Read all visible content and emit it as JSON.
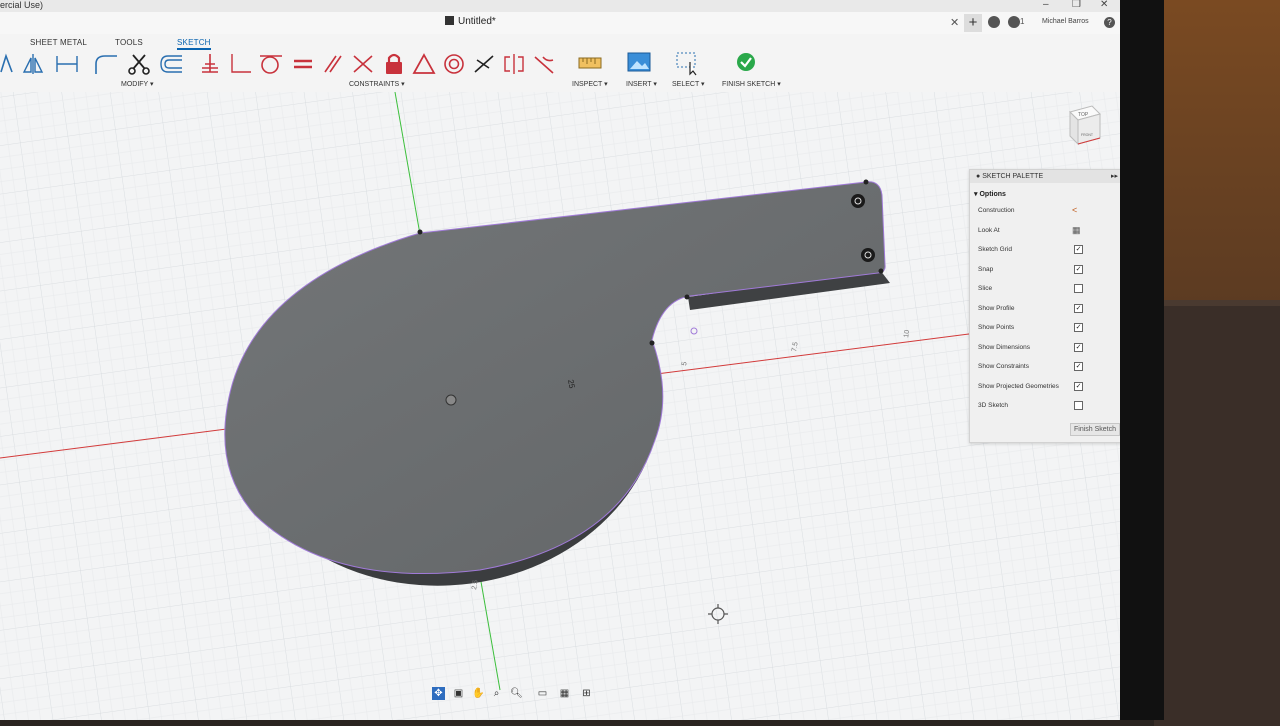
{
  "window": {
    "title_fragment": "ercial Use)",
    "document_title": "Untitled*",
    "notification_count": "1",
    "user_name": "Michael Barros",
    "help_glyph": "?"
  },
  "ribbon": {
    "tabs": [
      {
        "label": "SHEET METAL",
        "active": false
      },
      {
        "label": "TOOLS",
        "active": false
      },
      {
        "label": "SKETCH",
        "active": true
      }
    ],
    "groups": {
      "modify": "MODIFY ▾",
      "constraints": "CONSTRAINTS ▾",
      "inspect": "INSPECT ▾",
      "insert": "INSERT ▾",
      "select": "SELECT ▾",
      "finish": "FINISH SKETCH ▾"
    },
    "constraint_icons": [
      "horizontal-vertical-icon",
      "coincident-icon",
      "equal-icon",
      "parallel-icon",
      "perpendicular-icon",
      "fix-lock-icon",
      "midpoint-triangle-icon",
      "concentric-icon",
      "collinear-icon",
      "symmetry-icon",
      "tangent-icon"
    ],
    "colors": {
      "active_tab": "#0a64b0",
      "finish_green": "#2aa84a",
      "lock_red": "#c8323c"
    }
  },
  "viewport": {
    "dimension_label": "25",
    "axis_labels": [
      "5",
      "7.5",
      "10",
      "2.5"
    ],
    "viewcube": {
      "top": "TOP",
      "front": "FRONT"
    },
    "colors": {
      "x_axis": "#d23a3a",
      "y_axis": "#3cbf3c",
      "body": "#6b6e70",
      "edge": "#a07ad8"
    }
  },
  "sketch_palette": {
    "title": "SKETCH PALETTE",
    "section": "Options",
    "rows": [
      {
        "label": "Construction",
        "kind": "icon",
        "glyph": "<"
      },
      {
        "label": "Look At",
        "kind": "icon",
        "glyph": "▦"
      },
      {
        "label": "Sketch Grid",
        "kind": "check",
        "checked": true
      },
      {
        "label": "Snap",
        "kind": "check",
        "checked": true
      },
      {
        "label": "Slice",
        "kind": "check",
        "checked": false
      },
      {
        "label": "Show Profile",
        "kind": "check",
        "checked": true
      },
      {
        "label": "Show Points",
        "kind": "check",
        "checked": true
      },
      {
        "label": "Show Dimensions",
        "kind": "check",
        "checked": true
      },
      {
        "label": "Show Constraints",
        "kind": "check",
        "checked": true
      },
      {
        "label": "Show Projected Geometries",
        "kind": "check",
        "checked": true
      },
      {
        "label": "3D Sketch",
        "kind": "check",
        "checked": false
      }
    ],
    "finish_button": "Finish Sketch"
  },
  "navbar": {
    "icons": [
      "orbit-icon",
      "look-at-icon",
      "pan-icon",
      "zoom-window-icon",
      "zoom-icon",
      "display-settings-icon",
      "grid-settings-icon",
      "viewports-icon"
    ]
  }
}
